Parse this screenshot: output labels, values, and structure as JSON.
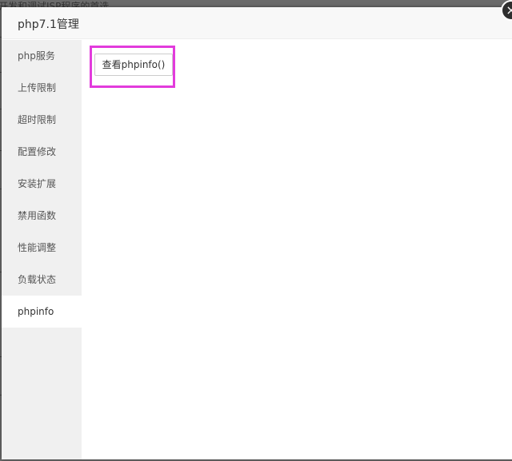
{
  "background": {
    "partial_text": "开发和调试JSP程序的首选"
  },
  "dialog": {
    "title": "php7.1管理",
    "close_icon": "×"
  },
  "sidebar": {
    "items": [
      {
        "label": "php服务"
      },
      {
        "label": "上传限制"
      },
      {
        "label": "超时限制"
      },
      {
        "label": "配置修改"
      },
      {
        "label": "安装扩展"
      },
      {
        "label": "禁用函数"
      },
      {
        "label": "性能调整"
      },
      {
        "label": "负载状态"
      },
      {
        "label": "phpinfo",
        "active": true
      }
    ]
  },
  "content": {
    "view_phpinfo_label": "查看phpinfo()"
  },
  "colors": {
    "highlight_border": "#e23bdc",
    "sidebar_bg": "#f0f0f0",
    "overlay_bg": "#6b6b6b"
  }
}
